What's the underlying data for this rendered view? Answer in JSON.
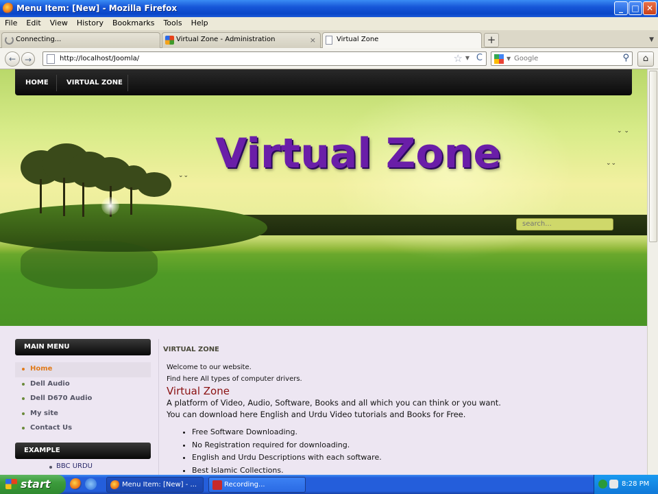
{
  "window": {
    "title": "Menu Item: [New] - Mozilla Firefox",
    "controls": {
      "minimize": "_",
      "maximize": "□",
      "close": "✕"
    }
  },
  "menubar": {
    "items": [
      "File",
      "Edit",
      "View",
      "History",
      "Bookmarks",
      "Tools",
      "Help"
    ]
  },
  "tabs": [
    {
      "label": "Connecting...",
      "icon": "loading-icon"
    },
    {
      "label": "Virtual Zone - Administration",
      "icon": "joomla-icon"
    },
    {
      "label": "Virtual Zone",
      "icon": "page-icon",
      "active": true
    }
  ],
  "tab_controls": {
    "new_tab": "+",
    "close": "×"
  },
  "navbar": {
    "url": "http://localhost/Joomla/",
    "search_placeholder": "Google",
    "back": "←",
    "forward": "→",
    "reload": "C",
    "star": "☆",
    "home": "⌂"
  },
  "site": {
    "nav": [
      "HOME",
      "VIRTUAL ZONE"
    ],
    "title": "Virtual Zone",
    "search_placeholder": "search...",
    "main_menu": {
      "heading": "MAIN MENU",
      "items": [
        "Home",
        "Dell Audio",
        "Dell D670 Audio",
        "My site",
        "Contact Us"
      ],
      "active_index": 0
    },
    "example": {
      "heading": "EXAMPLE",
      "items": [
        "BBC URDU"
      ]
    },
    "article": {
      "heading": "VIRTUAL ZONE",
      "welcome": "Welcome to our website.",
      "find": "Find here All types of computer drivers.",
      "subtitle": "Virtual Zone",
      "desc1": "A platform of Video, Audio, Software, Books and all which you can think or you want.",
      "desc2": "You can download here English and Urdu Video tutorials and Books for Free.",
      "bullets": [
        "Free Software Downloading.",
        "No Registration required for downloading.",
        "English and Urdu Descriptions with each software.",
        "Best Islamic Collections."
      ]
    }
  },
  "taskbar": {
    "start": "start",
    "buttons": [
      "Menu Item: [New] - ...",
      "Recording..."
    ],
    "clock": "8:28 PM"
  },
  "colors": {
    "title_text": "#6a1ea8",
    "subtitle": "#8a1010",
    "active_menu": "#e07a1a",
    "xp_blue": "#245edb",
    "start_green": "#3c9b3c"
  }
}
